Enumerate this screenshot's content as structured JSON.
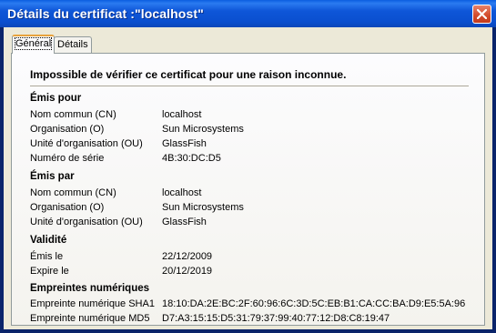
{
  "window": {
    "title": "Détails du certificat :\"localhost\""
  },
  "tabs": [
    {
      "label": "Général"
    },
    {
      "label": "Détails"
    }
  ],
  "warning": "Impossible de vérifier ce certificat pour une raison inconnue.",
  "issued_to": {
    "heading": "Émis pour",
    "rows": [
      {
        "label": "Nom commun (CN)",
        "value": "localhost"
      },
      {
        "label": "Organisation (O)",
        "value": "Sun Microsystems"
      },
      {
        "label": "Unité d'organisation (OU)",
        "value": "GlassFish"
      },
      {
        "label": "Numéro de série",
        "value": "4B:30:DC:D5"
      }
    ]
  },
  "issued_by": {
    "heading": "Émis par",
    "rows": [
      {
        "label": "Nom commun (CN)",
        "value": "localhost"
      },
      {
        "label": "Organisation (O)",
        "value": "Sun Microsystems"
      },
      {
        "label": "Unité d'organisation (OU)",
        "value": "GlassFish"
      }
    ]
  },
  "validity": {
    "heading": "Validité",
    "rows": [
      {
        "label": "Émis le",
        "value": "22/12/2009"
      },
      {
        "label": "Expire le",
        "value": "20/12/2019"
      }
    ]
  },
  "fingerprints": {
    "heading": "Empreintes numériques",
    "rows": [
      {
        "label": "Empreinte numérique SHA1",
        "value": "18:10:DA:2E:BC:2F:60:96:6C:3D:5C:EB:B1:CA:CC:BA:D9:E5:5A:96"
      },
      {
        "label": "Empreinte numérique MD5",
        "value": "D7:A3:15:15:D5:31:79:37:99:40:77:12:D8:C8:19:47"
      }
    ]
  }
}
